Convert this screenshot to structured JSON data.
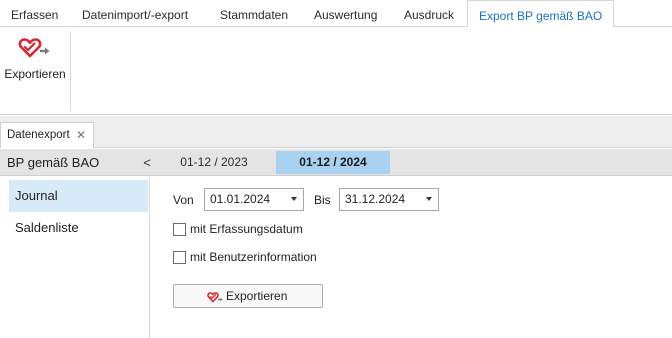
{
  "ribbon": {
    "tabs": [
      {
        "label": "Erfassen"
      },
      {
        "label": "Datenimport/-export"
      },
      {
        "label": "Stammdaten"
      },
      {
        "label": "Auswertung"
      },
      {
        "label": "Ausdruck"
      },
      {
        "label": "Export BP gemäß BAO",
        "active": true
      }
    ],
    "export_button": {
      "label": "Exportieren",
      "icon": "export-heart-arrow-icon"
    }
  },
  "document_tab": {
    "label": "Datenexport",
    "close_symbol": "✕"
  },
  "period_bar": {
    "title": "BP gemäß BAO",
    "prev_symbol": "<",
    "periods": [
      {
        "label": "01-12 / 2023",
        "selected": false
      },
      {
        "label": "01-12 / 2024",
        "selected": true
      }
    ]
  },
  "nav": {
    "items": [
      {
        "label": "Journal",
        "selected": true
      },
      {
        "label": "Saldenliste",
        "selected": false
      }
    ]
  },
  "form": {
    "from_label": "Von",
    "from_value": "01.01.2024",
    "to_label": "Bis",
    "to_value": "31.12.2024",
    "checkbox_erfassungsdatum": {
      "label": "mit Erfassungsdatum",
      "checked": false
    },
    "checkbox_benutzerinfo": {
      "label": "mit Benutzerinformation",
      "checked": false
    },
    "export_button": {
      "label": "Exportieren",
      "icon": "export-heart-arrow-icon"
    }
  },
  "colors": {
    "accent": "#1a6fc2",
    "selected_period_bg": "#a9d1f0",
    "selected_nav_bg": "#d6eaf8",
    "icon_red": "#d9262e"
  }
}
